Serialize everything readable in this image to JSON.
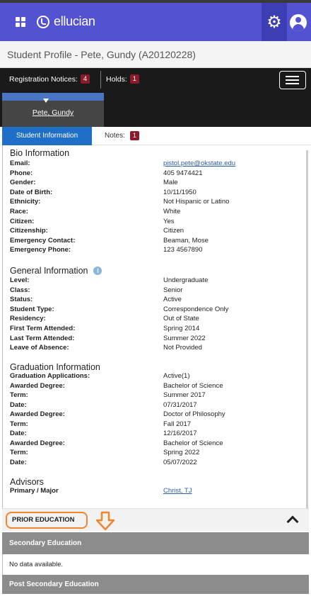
{
  "app": {
    "brand": "ellucian"
  },
  "header": {
    "title": "Student Profile - Pete, Gundy (A20120228)"
  },
  "notices": {
    "registration_label": "Registration Notices:",
    "registration_count": "4",
    "holds_label": "Holds:",
    "holds_count": "1"
  },
  "profile": {
    "name": "Pete, Gundy"
  },
  "tabs": {
    "student_info": "Student Information",
    "notes_label": "Notes:",
    "notes_count": "1"
  },
  "bio": {
    "title": "Bio Information",
    "rows": [
      {
        "label": "Email:",
        "value": "pistol.pete@okstate.edu"
      },
      {
        "label": "Phone:",
        "value": "405 9474421"
      },
      {
        "label": "Gender:",
        "value": "Male"
      },
      {
        "label": "Date of Birth:",
        "value": "10/11/1950"
      },
      {
        "label": "Ethnicity:",
        "value": "Not Hispanic or Latino"
      },
      {
        "label": "Race:",
        "value": "White"
      },
      {
        "label": "Citizen:",
        "value": "Yes"
      },
      {
        "label": "Citizenship:",
        "value": "Citizen"
      },
      {
        "label": "Emergency Contact:",
        "value": "Beaman, Mose"
      },
      {
        "label": "Emergency Phone:",
        "value": "123 4567890"
      }
    ]
  },
  "general": {
    "title": "General Information",
    "rows": [
      {
        "label": "Level:",
        "value": "Undergraduate"
      },
      {
        "label": "Class:",
        "value": "Senior"
      },
      {
        "label": "Status:",
        "value": "Active"
      },
      {
        "label": "Student Type:",
        "value": "Correspondence Only"
      },
      {
        "label": "Residency:",
        "value": "Out of State"
      },
      {
        "label": "First Term Attended:",
        "value": "Spring 2014"
      },
      {
        "label": "Last Term Attended:",
        "value": "Summer 2022"
      },
      {
        "label": "Leave of Absence:",
        "value": "Not Provided"
      }
    ]
  },
  "graduation": {
    "title": "Graduation Information",
    "rows": [
      {
        "label": "Graduation Applications:",
        "value": "Active(1)"
      },
      {
        "label": "Awarded Degree:",
        "value": "Bachelor of Science"
      },
      {
        "label": "Term:",
        "value": "Summer 2017"
      },
      {
        "label": "Date:",
        "value": "07/31/2017"
      },
      {
        "label": "Awarded Degree:",
        "value": "Doctor of Philosophy"
      },
      {
        "label": "Term:",
        "value": "Fall 2017"
      },
      {
        "label": "Date:",
        "value": "12/16/2017"
      },
      {
        "label": "Awarded Degree:",
        "value": "Bachelor of Science"
      },
      {
        "label": "Term:",
        "value": "Spring 2022"
      },
      {
        "label": "Date:",
        "value": "05/07/2022"
      }
    ]
  },
  "advisors": {
    "title": "Advisors",
    "rows": [
      {
        "label": "Primary / Major",
        "value": "Christ, TJ"
      }
    ]
  },
  "prior_education": {
    "title": "PRIOR EDUCATION",
    "secondary_title": "Secondary Education",
    "no_data": "No data available.",
    "post_secondary_title": "Post Secondary Education"
  },
  "colors": {
    "topbar": "#5353d1",
    "active_tab": "#1f6fc8",
    "badge": "#8b1a2b",
    "annotation": "#f0852d"
  },
  "icons": [
    "apps-grid-icon",
    "settings-gear-icon",
    "user-avatar-icon",
    "hamburger-menu-icon",
    "info-icon",
    "chevron-up-icon",
    "down-arrow-annotation-icon"
  ]
}
